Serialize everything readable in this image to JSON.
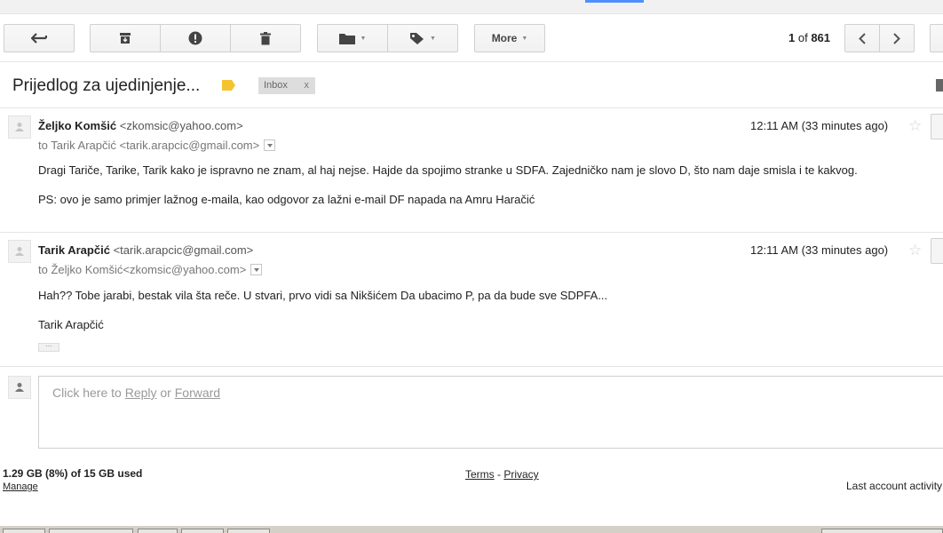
{
  "toolbar": {
    "buttons": {
      "back": "back-arrow-icon",
      "archive": "archive-icon",
      "spam": "report-spam-icon",
      "delete": "trash-icon",
      "move": "folder-icon",
      "labels": "label-icon"
    },
    "more_label": "More",
    "pager": {
      "current": "1",
      "of": "of",
      "total": "861"
    }
  },
  "subject": "Prijedlog za ujedinjenje...",
  "inbox_chip": {
    "label": "Inbox",
    "close": "x"
  },
  "messages": [
    {
      "sender_name": "Željko Komšić",
      "sender_email": "<zkomsic@yahoo.com>",
      "to_line": "to Tarik Arapčić <tarik.arapcic@gmail.com>",
      "time": "12:11 AM (33 minutes ago)",
      "body_lines": [
        "Dragi Tariče, Tarike, Tarik kako je ispravno ne znam, al haj nejse. Hajde da spojimo stranke u SDFA. Zajedničko nam je slovo D, što nam daje smisla i te kakvog.",
        "PS: ovo je samo primjer lažnog e-maila, kao odgovor za lažni e-mail DF napada na Amru Haračić"
      ]
    },
    {
      "sender_name": "Tarik Arapčić",
      "sender_email": "<tarik.arapcic@gmail.com>",
      "to_line": "to Željko Komšić<zkomsic@yahoo.com>",
      "time": "12:11 AM (33 minutes ago)",
      "body_lines": [
        "Hah?? Tobe jarabi, bestak vila šta reče. U stvari, prvo vidi sa Nikšićem Da ubacimo P, pa da bude sve SDPFA...",
        "Tarik Arapčić"
      ],
      "ellipsis": "···"
    }
  ],
  "reply": {
    "prefix": "Click here to ",
    "reply_link": "Reply",
    "or": " or ",
    "forward_link": "Forward"
  },
  "footer": {
    "storage": "1.29 GB (8%) of 15 GB used",
    "manage": "Manage",
    "terms": "Terms",
    "sep": " - ",
    "privacy": "Privacy",
    "last_activity": "Last account activity"
  },
  "colors": {
    "accent_blue": "#4d90fe",
    "label_yellow": "#f4c430",
    "chip_bg": "#dddddd"
  }
}
